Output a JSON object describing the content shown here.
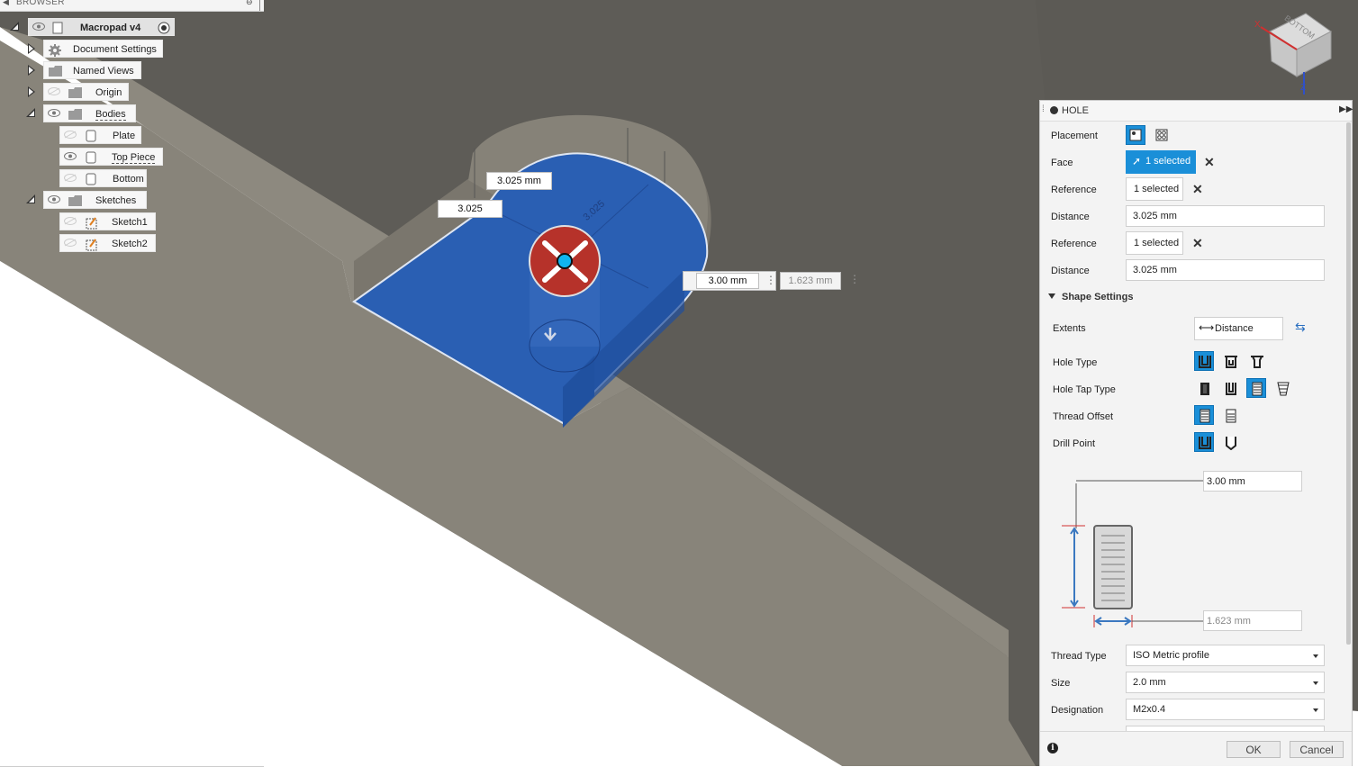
{
  "browser": {
    "header": "BROWSER",
    "root": "Macropad v4",
    "items": [
      {
        "label": "Document Settings"
      },
      {
        "label": "Named Views"
      },
      {
        "label": "Origin"
      },
      {
        "label": "Bodies"
      },
      {
        "label": "Plate"
      },
      {
        "label": "Top Piece"
      },
      {
        "label": "Bottom"
      },
      {
        "label": "Sketches"
      },
      {
        "label": "Sketch1"
      },
      {
        "label": "Sketch2"
      }
    ]
  },
  "viewcube": {
    "face": "BOTTOM",
    "x_axis": "X",
    "z_axis": "Z"
  },
  "canvas": {
    "dim_top": "3.025 mm",
    "dim_left": "3.025",
    "dim_diag": "3.025",
    "depth_value": "3.00 mm",
    "dia_value": "1.623 mm"
  },
  "hole": {
    "title": "HOLE",
    "placement_label": "Placement",
    "face_label": "Face",
    "face_value": "1 selected",
    "reference1_label": "Reference",
    "reference1_value": "1 selected",
    "distance1_label": "Distance",
    "distance1_value": "3.025 mm",
    "reference2_label": "Reference",
    "reference2_value": "1 selected",
    "distance2_label": "Distance",
    "distance2_value": "3.025 mm",
    "shape_settings": "Shape Settings",
    "extents_label": "Extents",
    "extents_value": "Distance",
    "hole_type_label": "Hole Type",
    "hole_tap_type_label": "Hole Tap Type",
    "thread_offset_label": "Thread Offset",
    "drill_point_label": "Drill Point",
    "depth_value": "3.00 mm",
    "diameter_value": "1.623 mm",
    "thread_type_label": "Thread Type",
    "thread_type_value": "ISO Metric profile",
    "size_label": "Size",
    "size_value": "2.0 mm",
    "designation_label": "Designation",
    "designation_value": "M2x0.4",
    "ok": "OK",
    "cancel": "Cancel",
    "accent": "#1a8fd8"
  }
}
